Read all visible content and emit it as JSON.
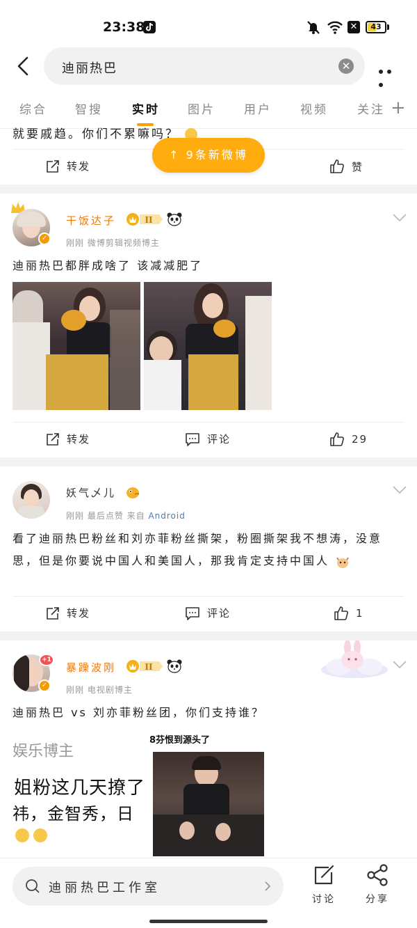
{
  "status_bar": {
    "time": "23:38",
    "battery": "43",
    "battery_level": 0.43
  },
  "search": {
    "query": "迪丽热巴"
  },
  "tabs": [
    {
      "label": "综合"
    },
    {
      "label": "智搜"
    },
    {
      "label": "实时"
    },
    {
      "label": "图片"
    },
    {
      "label": "用户"
    },
    {
      "label": "视频"
    },
    {
      "label": "关注"
    }
  ],
  "partial_post": {
    "text": "就要戚趋。你们不累嘛吗？",
    "repost_label": "转发",
    "like_label": "赞"
  },
  "new_posts_pill": "↑ 9条新微博",
  "posts": [
    {
      "username": "干饭达子",
      "vip_level": "II",
      "meta": "刚刚  微博剪辑视频博主",
      "text": "迪丽热巴都胖成啥了 该减减肥了",
      "actions": {
        "repost": "转发",
        "comment": "评论",
        "like": "29"
      }
    },
    {
      "username": "妖气乄儿",
      "meta_prefix": "刚刚 最后点赞  来自 ",
      "meta_source": "Android",
      "text": "看了迪丽热巴粉丝和刘亦菲粉丝撕架，粉圈撕架我不想涛，没意思，但是你要说中国人和美国人，那我肯定支持中国人",
      "actions": {
        "repost": "转发",
        "comment": "评论",
        "like": "1"
      }
    },
    {
      "username": "暴躁波刚",
      "vip_level": "II",
      "avatar_badge": "+1",
      "meta": "刚刚  电视剧博主",
      "text": "迪丽热巴 vs 刘亦菲粉丝团，你们支持谁？",
      "embed": {
        "header": "娱乐博主",
        "line1": "姐粉这几天撩了",
        "line2": "祎，金智秀，日",
        "video_title": "8芬恨到源头了"
      }
    }
  ],
  "bottom_bar": {
    "search_text": "迪丽热巴工作室",
    "discuss_label": "讨论",
    "share_label": "分享"
  }
}
